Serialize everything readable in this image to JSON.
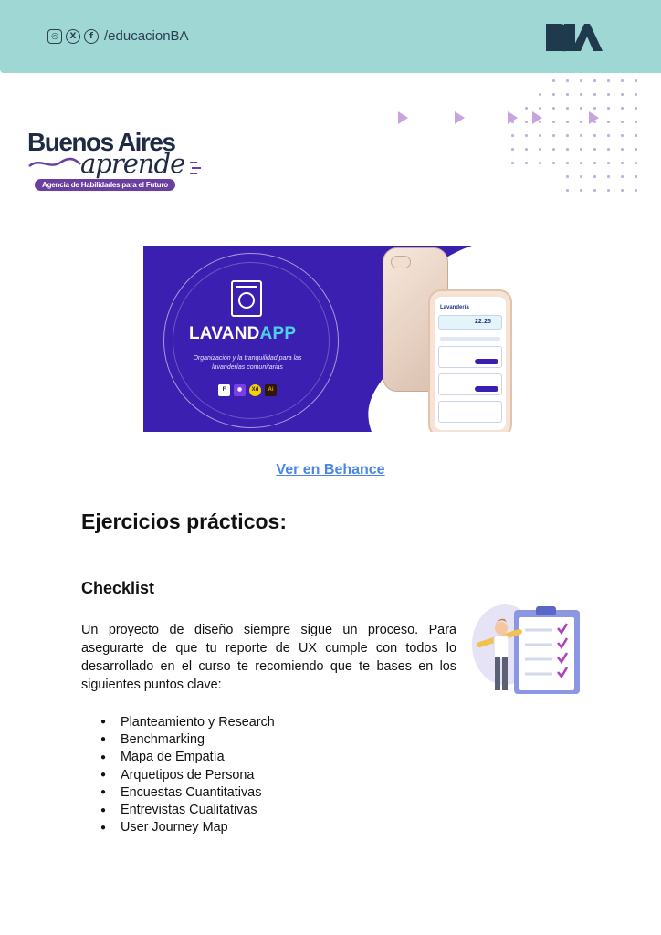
{
  "header": {
    "social_handle": "/educacionBA",
    "icons": [
      "instagram-icon",
      "x-icon",
      "facebook-icon"
    ],
    "brand_logo": "BA",
    "band_color": "#9ed7d3"
  },
  "logo": {
    "title": "Buenos Aires",
    "subtitle": "aprende",
    "tagline": "Agencia de Habilidades para el Futuro",
    "accent_color": "#6a3fa0"
  },
  "banner": {
    "app_name_part1": "LAVAND",
    "app_name_part2": "APP",
    "tagline": "Organización y la tranquilidad para las lavanderías comunitarias",
    "tools": [
      "F",
      "◉",
      "Xd",
      "Ai"
    ],
    "phone_title": "Lavandería",
    "phone_time": "22:25",
    "background_color": "#3a1fb0"
  },
  "link": {
    "label": "Ver en Behance"
  },
  "section_title": "Ejercicios prácticos:",
  "subsection_title": "Checklist",
  "paragraph": "Un proyecto de diseño siempre sigue un proceso. Para asegurarte de que tu reporte de UX cumple con todos lo desarrollado en el curso te recomiendo que te bases en los siguientes puntos clave:",
  "checklist": [
    "Planteamiento y Research",
    "Benchmarking",
    "Mapa de Empatía",
    "Arquetipos de Persona",
    "Encuestas Cuantitativas",
    "Entrevistas Cualitativas",
    "User Journey Map"
  ]
}
